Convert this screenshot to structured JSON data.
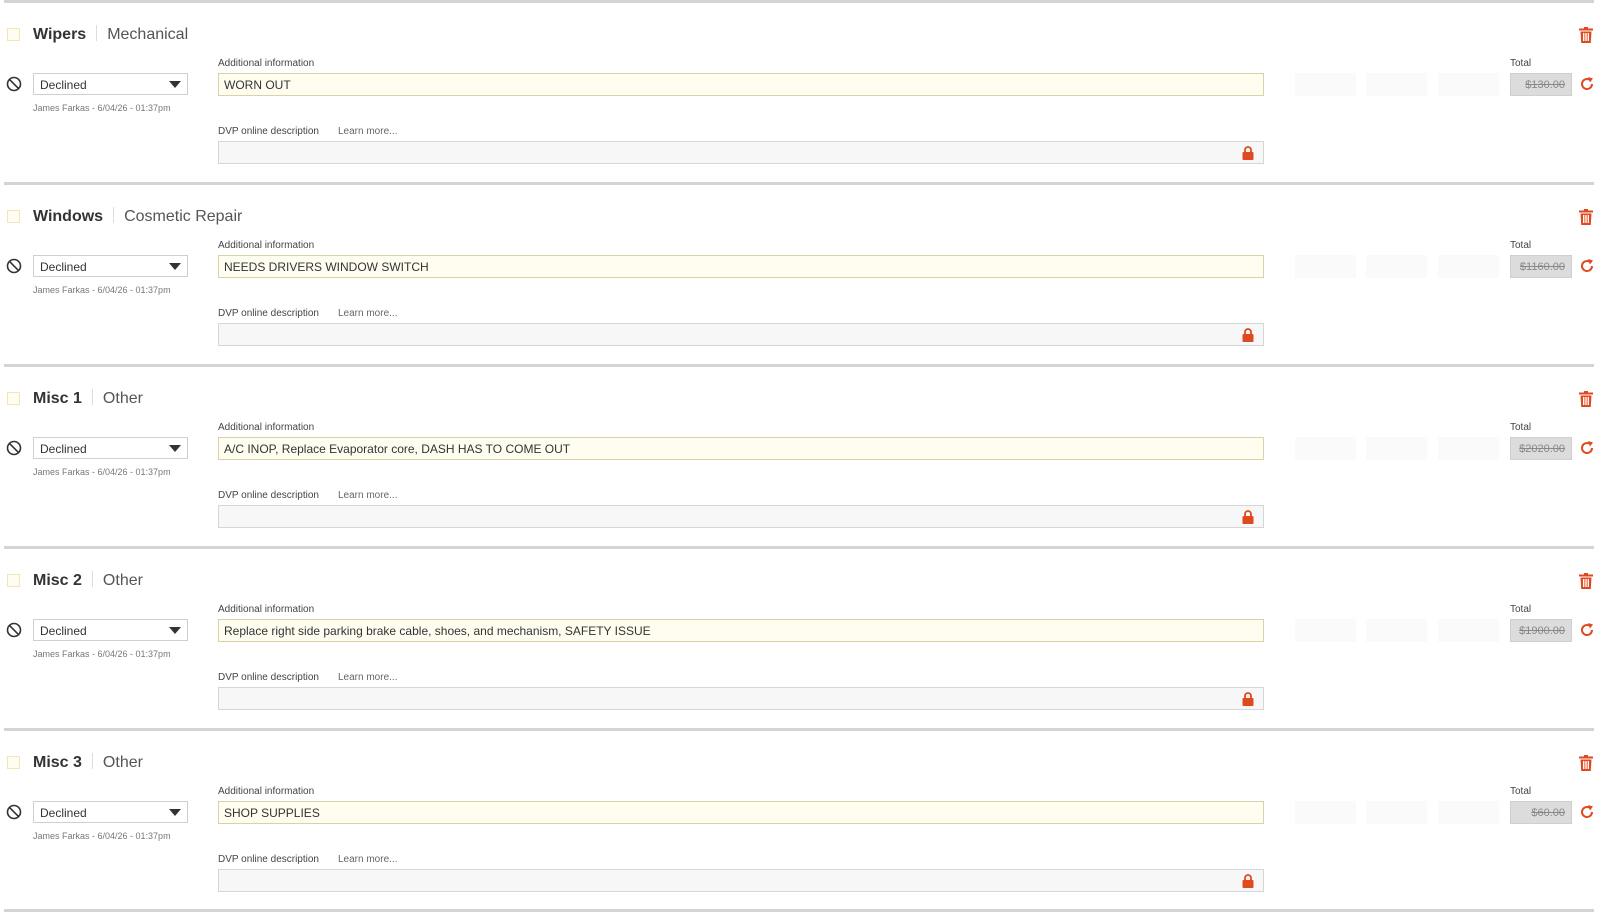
{
  "labels": {
    "additional_information": "Additional information",
    "dvp_online_description": "DVP online description",
    "learn_more": "Learn more...",
    "total": "Total"
  },
  "colors": {
    "accent": "#e0491f",
    "checkbox_border": "#f0e6b8",
    "input_highlight": "#fffdef"
  },
  "icons": {
    "trash": "trash-icon",
    "declined": "declined-icon",
    "reset": "reset-icon",
    "lock": "lock-icon",
    "caret": "chevron-down-icon"
  },
  "items": [
    {
      "name": "Wipers",
      "category": "Mechanical",
      "status": "Declined",
      "author": "James Farkas - 6/04/26 - 01:37pm",
      "additional_info": "WORN OUT",
      "dvp_description": "",
      "total": "$130.00"
    },
    {
      "name": "Windows",
      "category": "Cosmetic Repair",
      "status": "Declined",
      "author": "James Farkas - 6/04/26 - 01:37pm",
      "additional_info": "NEEDS DRIVERS WINDOW SWITCH",
      "dvp_description": "",
      "total": "$1160.00"
    },
    {
      "name": "Misc 1",
      "category": "Other",
      "status": "Declined",
      "author": "James Farkas - 6/04/26 - 01:37pm",
      "additional_info": "A/C INOP, Replace Evaporator core, DASH HAS TO COME OUT",
      "dvp_description": "",
      "total": "$2020.00"
    },
    {
      "name": "Misc 2",
      "category": "Other",
      "status": "Declined",
      "author": "James Farkas - 6/04/26 - 01:37pm",
      "additional_info": "Replace right side parking brake cable, shoes, and mechanism, SAFETY ISSUE",
      "dvp_description": "",
      "total": "$1900.00"
    },
    {
      "name": "Misc 3",
      "category": "Other",
      "status": "Declined",
      "author": "James Farkas - 6/04/26 - 01:37pm",
      "additional_info": "SHOP SUPPLIES",
      "dvp_description": "",
      "total": "$60.00"
    }
  ]
}
